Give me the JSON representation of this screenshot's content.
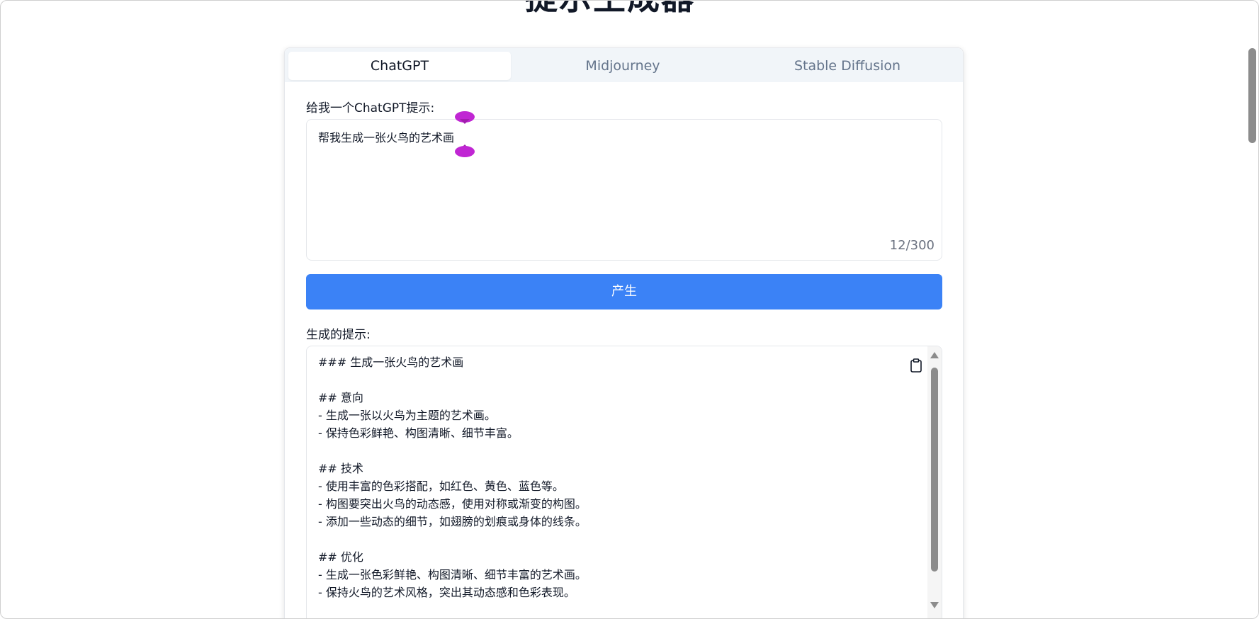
{
  "page": {
    "title": "提示生成器"
  },
  "tabs": [
    {
      "label": "ChatGPT",
      "active": true
    },
    {
      "label": "Midjourney",
      "active": false
    },
    {
      "label": "Stable Diffusion",
      "active": false
    }
  ],
  "prompt": {
    "label": "给我一个ChatGPT提示:",
    "value": "帮我生成一张火鸟的艺术画",
    "counter": "12/300"
  },
  "generate_button": {
    "label": "产生"
  },
  "output": {
    "label": "生成的提示:",
    "lines": [
      "### 生成一张火鸟的艺术画",
      "",
      "## 意向",
      "- 生成一张以火鸟为主题的艺术画。",
      "- 保持色彩鲜艳、构图清晰、细节丰富。",
      "",
      "## 技术",
      "- 使用丰富的色彩搭配，如红色、黄色、蓝色等。",
      "- 构图要突出火鸟的动态感，使用对称或渐变的构图。",
      "- 添加一些动态的细节，如翅膀的划痕或身体的线条。",
      "",
      "## 优化",
      "- 生成一张色彩鲜艳、构图清晰、细节丰富的艺术画。",
      "- 保持火鸟的艺术风格，突出其动态感和色彩表现。"
    ]
  },
  "icons": {
    "copy": "clipboard-icon",
    "selection_handle": "selection-handle-icon"
  },
  "colors": {
    "accent": "#3b82f6",
    "handle": "#c026d3",
    "tab_bar": "#f1f5f9"
  }
}
